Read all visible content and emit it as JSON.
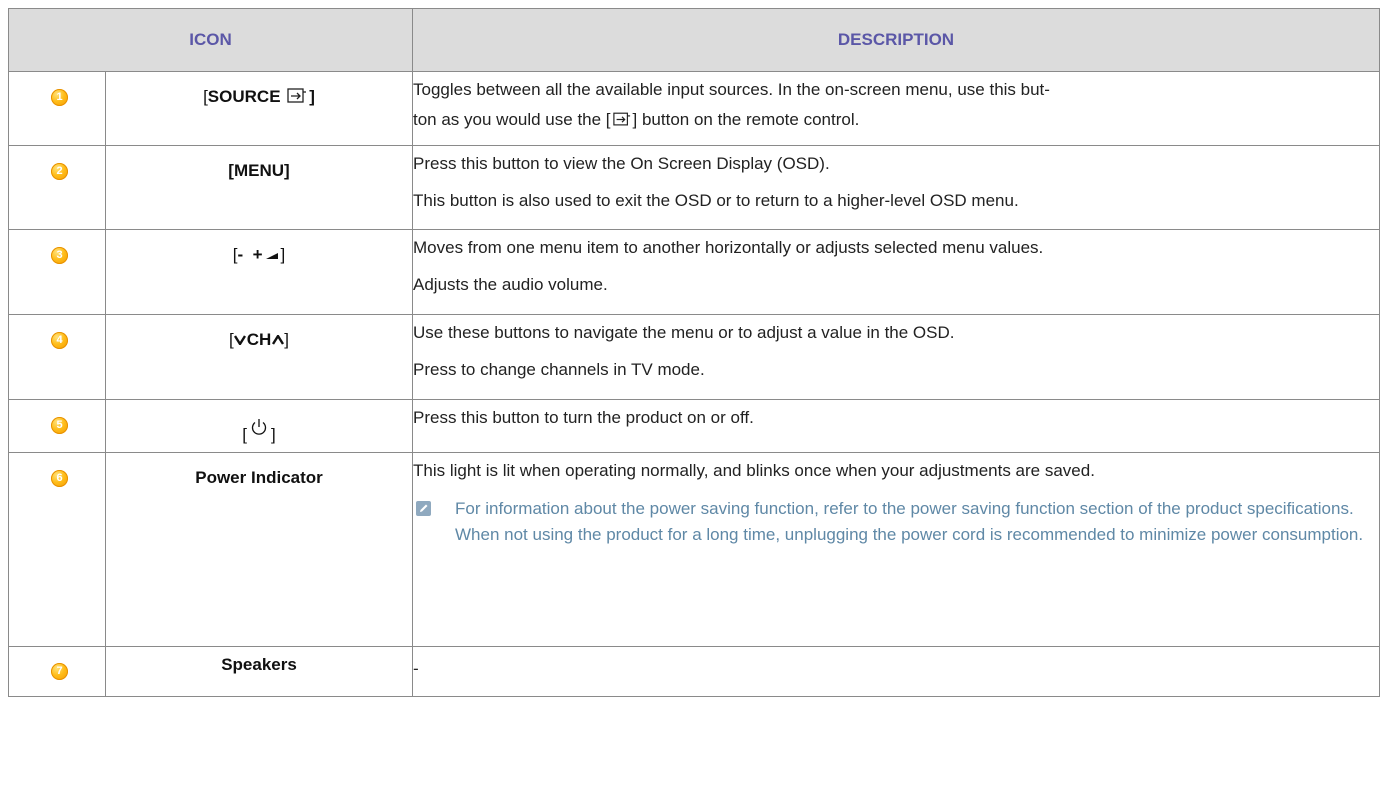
{
  "header": {
    "icon_col": "ICON",
    "desc_col": "DESCRIPTION"
  },
  "rows": [
    {
      "num": "1",
      "label_open": "[",
      "label": "SOURCE",
      "label_close": "]",
      "desc": [
        "Toggles between all the available input sources. In the on-screen menu, use this but-",
        "ton as you would use the [",
        "] button on the remote control."
      ]
    },
    {
      "num": "2",
      "label": "[MENU]",
      "desc": [
        "Press this button to view the On Screen Display (OSD).",
        "This button is also used to exit the OSD or to return to a higher-level OSD menu."
      ]
    },
    {
      "num": "3",
      "label_open": "[",
      "label": "-  +",
      "label_close": "]",
      "desc": [
        "Moves from one menu item to another horizontally or adjusts selected menu values.",
        "Adjusts the audio volume."
      ]
    },
    {
      "num": "4",
      "label_open": "[",
      "label": "CH",
      "label_close": "]",
      "desc": [
        "Use these buttons to navigate the menu or to adjust a value in the OSD.",
        "Press to change channels in TV mode."
      ]
    },
    {
      "num": "5",
      "label_open": "[",
      "label_close": "]",
      "desc": [
        "Press this button to turn the product on or off."
      ]
    },
    {
      "num": "6",
      "label": "Power Indicator",
      "desc": [
        "This light is lit when operating normally, and blinks once when your adjustments are saved."
      ],
      "note": "For information about the power saving function, refer to the power saving function section of the product specifications. When not using the product for a long time, unplugging the power cord is recommended to minimize power consumption."
    },
    {
      "num": "7",
      "label": "Speakers",
      "desc": [
        "-"
      ]
    }
  ],
  "colors": {
    "header_bg": "#dcdcdc",
    "header_text": "#5b57a7",
    "badge": "#f5a300",
    "note_text": "#5f88a6",
    "border": "#8a8a8a"
  },
  "icons": [
    "source-icon",
    "volume-icon",
    "chevron-down-icon",
    "chevron-up-icon",
    "power-icon",
    "note-icon"
  ]
}
